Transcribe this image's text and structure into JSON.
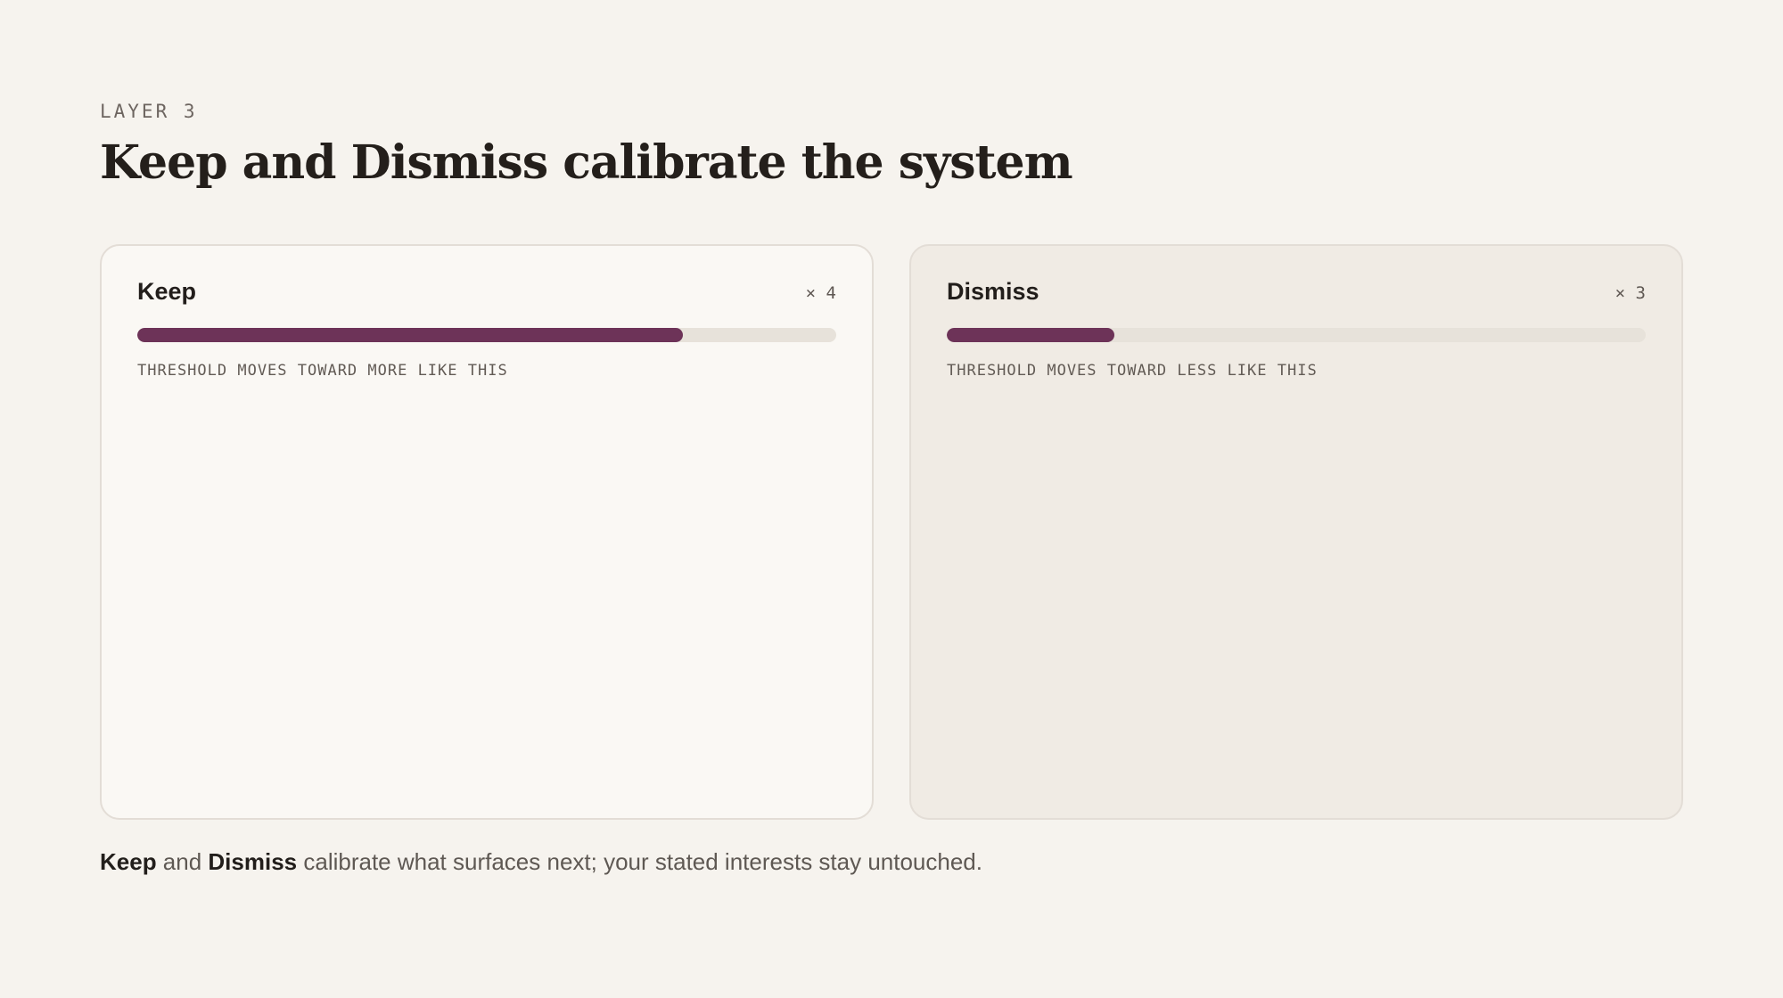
{
  "header": {
    "eyebrow": "LAYER 3",
    "title": "Keep and Dismiss calibrate the system"
  },
  "cards": [
    {
      "title": "Keep",
      "count": "× 4",
      "fill_fraction": 0.78,
      "caption": "THRESHOLD MOVES TOWARD MORE LIKE THIS"
    },
    {
      "title": "Dismiss",
      "count": "× 3",
      "fill_fraction": 0.24,
      "caption": "THRESHOLD MOVES TOWARD LESS LIKE THIS"
    }
  ],
  "footnote": {
    "keep": "Keep",
    "and": " and ",
    "dismiss": "Dismiss",
    "rest": " calibrate what surfaces next; your stated interests stay untouched."
  },
  "colors": {
    "background": "#f6f3ee",
    "accent": "#6d3358",
    "track": "#e7e2da"
  }
}
